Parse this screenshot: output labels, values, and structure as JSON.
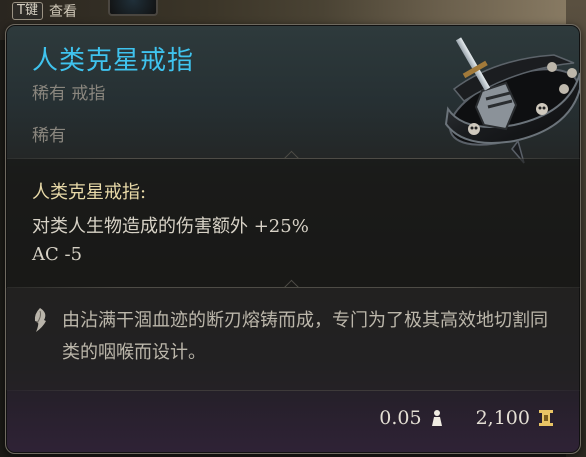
{
  "hud": {
    "hotkey": "T键",
    "action": "查看"
  },
  "item": {
    "name": "人类克星戒指",
    "type": "稀有 戒指",
    "rarity": "稀有",
    "effect_title": "人类克星戒指:",
    "effects": [
      "对类人生物造成的伤害额外 +25%",
      "AC -5"
    ],
    "flavor": "由沾满干涸血迹的断刃熔铸而成，专门为了极其高效地切割同类的咽喉而设计。",
    "weight": "0.05",
    "value": "2,100"
  },
  "colors": {
    "title": "#3fc3ee",
    "effect_title": "#e8d9a8",
    "text": "#d7d2c6",
    "muted": "#8a867e"
  },
  "icons": {
    "weight": "weight-icon",
    "value": "gold-icon",
    "flavor": "quill-icon",
    "item": "ring-icon"
  }
}
